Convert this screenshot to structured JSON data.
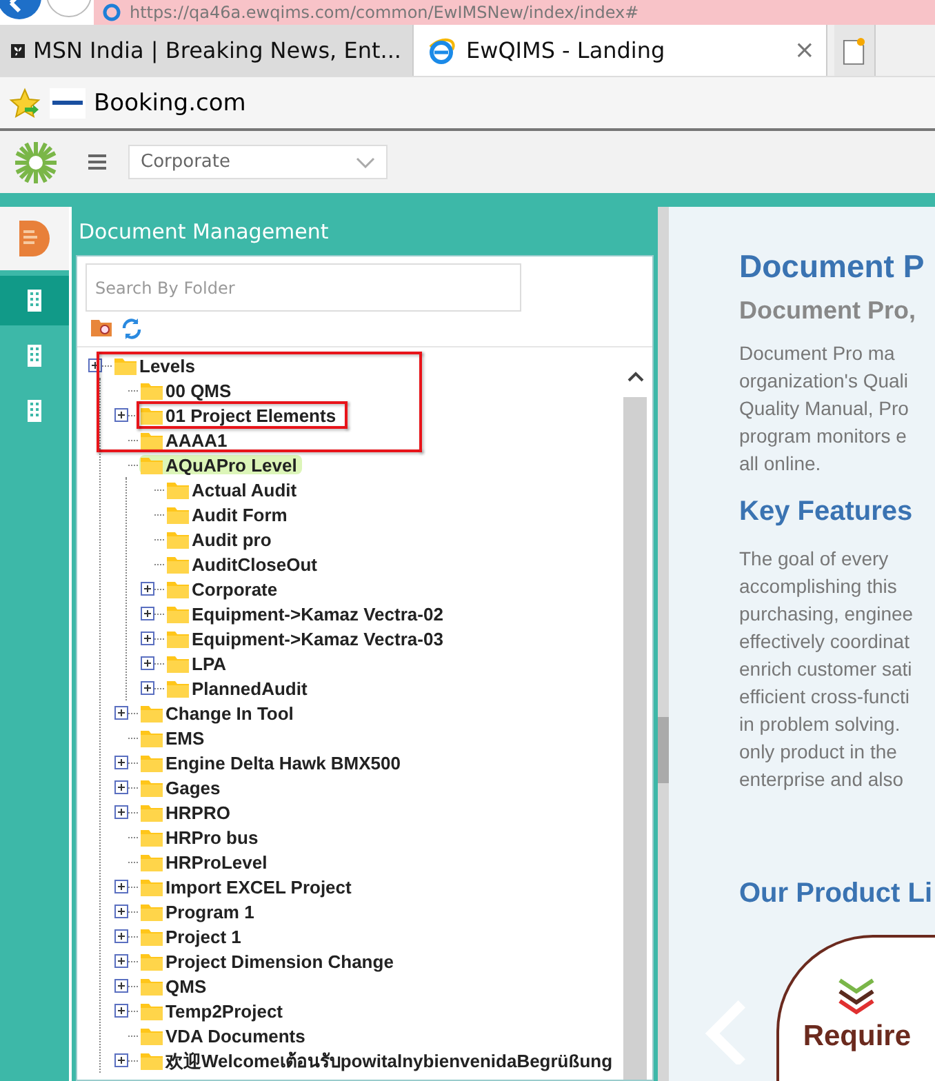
{
  "browser": {
    "address": "https://qa46a.ewqims.com/common/EwIMSNew/index/index#",
    "tabs": [
      {
        "title": "MSN India | Breaking News, Ent...",
        "kind": "msn",
        "selected": false
      },
      {
        "title": "EwQIMS - Landing",
        "kind": "ie",
        "selected": true,
        "close": "×"
      }
    ],
    "favorites": [
      {
        "label": "Booking.com"
      }
    ]
  },
  "app_header": {
    "company_select": "Corporate"
  },
  "side_rail": [
    {
      "kind": "document",
      "selected": false
    },
    {
      "kind": "building",
      "selected": true
    },
    {
      "kind": "building",
      "selected": false
    },
    {
      "kind": "building",
      "selected": false
    }
  ],
  "document_panel": {
    "title": "Document Management",
    "search": {
      "placeholder": "Search By Folder"
    },
    "tree": [
      {
        "label": "Levels",
        "toggle": true,
        "selected": false,
        "children": [
          {
            "label": "00 QMS",
            "toggle": false,
            "selected": false
          },
          {
            "label": "01 Project Elements",
            "toggle": true,
            "selected": false
          },
          {
            "label": "AAAA1",
            "toggle": false,
            "selected": false
          },
          {
            "label": "AQuAPro Level",
            "toggle": false,
            "selected": true,
            "children": [
              {
                "label": "Actual Audit",
                "toggle": false,
                "selected": false
              },
              {
                "label": "Audit Form",
                "toggle": false,
                "selected": false
              },
              {
                "label": "Audit pro",
                "toggle": false,
                "selected": false
              },
              {
                "label": "AuditCloseOut",
                "toggle": false,
                "selected": false
              },
              {
                "label": "Corporate",
                "toggle": true,
                "selected": false
              },
              {
                "label": "Equipment->Kamaz Vectra-02",
                "toggle": true,
                "selected": false
              },
              {
                "label": "Equipment->Kamaz Vectra-03",
                "toggle": true,
                "selected": false
              },
              {
                "label": "LPA",
                "toggle": true,
                "selected": false
              },
              {
                "label": "PlannedAudit",
                "toggle": true,
                "selected": false
              }
            ]
          },
          {
            "label": "Change In Tool",
            "toggle": true,
            "selected": false
          },
          {
            "label": "EMS",
            "toggle": false,
            "selected": false
          },
          {
            "label": "Engine Delta Hawk BMX500",
            "toggle": true,
            "selected": false
          },
          {
            "label": "Gages",
            "toggle": true,
            "selected": false
          },
          {
            "label": "HRPRO",
            "toggle": true,
            "selected": false
          },
          {
            "label": "HRPro bus",
            "toggle": false,
            "selected": false
          },
          {
            "label": "HRProLevel",
            "toggle": false,
            "selected": false
          },
          {
            "label": "Import EXCEL Project",
            "toggle": true,
            "selected": false
          },
          {
            "label": "Program 1",
            "toggle": true,
            "selected": false
          },
          {
            "label": "Project 1",
            "toggle": true,
            "selected": false
          },
          {
            "label": "Project Dimension Change",
            "toggle": true,
            "selected": false
          },
          {
            "label": "QMS",
            "toggle": true,
            "selected": false
          },
          {
            "label": "Temp2Project",
            "toggle": true,
            "selected": false
          },
          {
            "label": "VDA Documents",
            "toggle": false,
            "selected": false
          },
          {
            "label": "欢迎Welcomeเต้อนรับpowitalnybienvenidaBegrüßung",
            "toggle": true,
            "selected": false
          }
        ]
      }
    ]
  },
  "annotation_frames": [
    {
      "kind": "rectangle"
    },
    {
      "kind": "rectangle"
    }
  ],
  "content": {
    "title": "Document P",
    "subtitle": "Document Pro,",
    "intro": [
      "Document Pro ma",
      "organization's Quali",
      "Quality Manual, Pro",
      "program monitors e",
      "all online."
    ],
    "features_title": "Key Features",
    "features": [
      "The goal of every",
      "accomplishing this",
      "purchasing, enginee",
      "effectively coordinat",
      "enrich customer sati",
      "efficient cross-functi",
      "in problem solving.",
      "only product in the",
      "enterprise and also"
    ],
    "products_title": "Our Product Li",
    "product_logo": "Require"
  }
}
